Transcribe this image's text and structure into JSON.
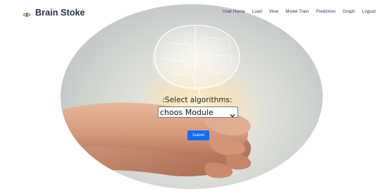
{
  "header": {
    "brand": "Brain Stoke",
    "brand_icon": "eye-icon",
    "nav": [
      "User Home",
      "Load",
      "View",
      "Model Train",
      "Prediction",
      "Graph",
      "Logout"
    ]
  },
  "form": {
    "label": ":Select algorithms:",
    "select_value": "choos Module",
    "submit_label": "Submit"
  },
  "colors": {
    "brand_text": "#1f2d44",
    "nav_text": "#2a3c68",
    "submit_button": "#0d6efd"
  }
}
